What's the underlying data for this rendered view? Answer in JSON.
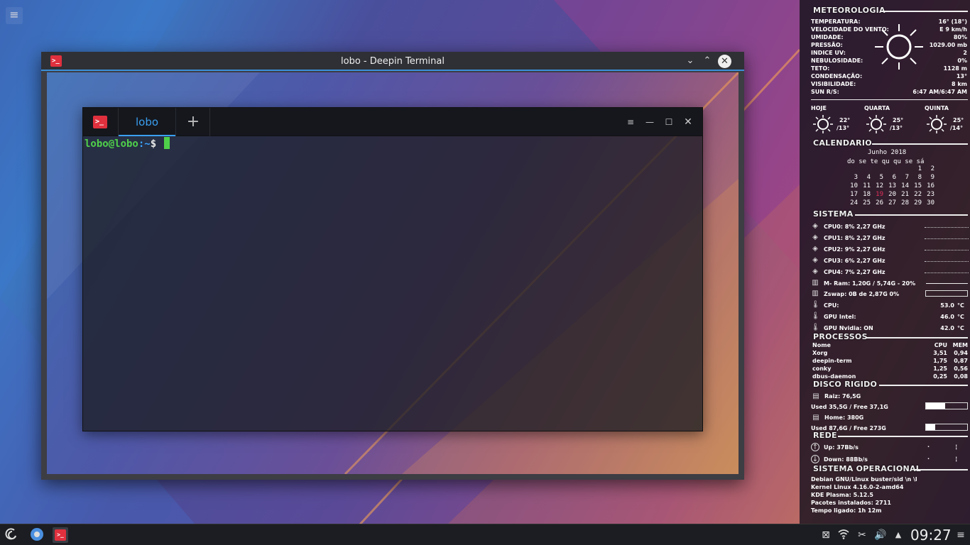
{
  "outer_window": {
    "title": "lobo - Deepin Terminal",
    "icon_glyph": ">_",
    "min": "⌄",
    "max": "⌃",
    "close": "✕"
  },
  "terminal": {
    "icon_glyph": ">_",
    "tab_label": "lobo",
    "add_tab": "+",
    "menu": "≡",
    "min": "—",
    "max": "☐",
    "close": "✕",
    "prompt_user": "lobo@lobo",
    "prompt_path": ":~",
    "prompt_symbol": "$ "
  },
  "desktop": {
    "menu_glyph": "≡"
  },
  "conky": {
    "meteorologia": {
      "title": "METEOROLOGIA",
      "rows": [
        {
          "k": "TEMPERATURA:",
          "v": "16° (18°)"
        },
        {
          "k": "VELOCIDADE DO VENTO:",
          "v": "E 9 km/h"
        },
        {
          "k": "UMIDADE:",
          "v": "80%"
        },
        {
          "k": "PRESSÃO:",
          "v": "1029.00 mb"
        },
        {
          "k": "INDICE UV:",
          "v": "2"
        },
        {
          "k": "NEBULOSIDADE:",
          "v": "0%"
        },
        {
          "k": "TETO:",
          "v": "1128 m"
        },
        {
          "k": "CONDENSAÇÃO:",
          "v": "13°"
        },
        {
          "k": "VISIBILIDADE:",
          "v": "8 km"
        },
        {
          "k": "SUN R/S:",
          "v": "6:47 AM/6:47 AM"
        }
      ],
      "forecast": [
        {
          "day": "HOJE",
          "hi": "22°",
          "lo": "/13°"
        },
        {
          "day": "QUARTA",
          "hi": "25°",
          "lo": "/13°"
        },
        {
          "day": "QUINTA",
          "hi": "25°",
          "lo": "/14°"
        }
      ]
    },
    "calendario": {
      "title": "CALENDARIO",
      "month": "Junho 2018",
      "weekdays": "do se te qu qu se sá",
      "weeks": [
        [
          "",
          "",
          "",
          "",
          "",
          "1",
          "2"
        ],
        [
          "3",
          "4",
          "5",
          "6",
          "7",
          "8",
          "9"
        ],
        [
          "10",
          "11",
          "12",
          "13",
          "14",
          "15",
          "16"
        ],
        [
          "17",
          "18",
          "19",
          "20",
          "21",
          "22",
          "23"
        ],
        [
          "24",
          "25",
          "26",
          "27",
          "28",
          "29",
          "30"
        ]
      ],
      "today": "19"
    },
    "sistema": {
      "title": "SISTEMA",
      "cpus": [
        {
          "label": "CPU0: 8%  2,27 GHz"
        },
        {
          "label": "CPU1: 8%  2,27 GHz"
        },
        {
          "label": "CPU2: 9%  2,27 GHz"
        },
        {
          "label": "CPU3: 6%  2,27 GHz"
        },
        {
          "label": "CPU4: 7%  2,27 GHz"
        }
      ],
      "ram": {
        "label": "M- Ram:  1,20G / 5,74G - 20%",
        "fraction": 0.2
      },
      "swap": {
        "label": "Zswap:  0B de 2,87G  0%",
        "fraction": 0
      },
      "temps": [
        {
          "k": "CPU:",
          "v": "53.0",
          "u": "°C"
        },
        {
          "k": "GPU Intel:",
          "v": "46.0",
          "u": "°C"
        },
        {
          "k": "GPU Nvidia: ON",
          "v": "42.0",
          "u": "°C"
        }
      ]
    },
    "processos": {
      "title": "PROCESSOS",
      "header": {
        "name": "Nome",
        "cpu": "CPU",
        "mem": "MEM"
      },
      "rows": [
        {
          "name": "Xorg",
          "cpu": "3,51",
          "mem": "0,94"
        },
        {
          "name": "deepin-term",
          "cpu": "1,75",
          "mem": "0,87"
        },
        {
          "name": "conky",
          "cpu": "1,25",
          "mem": "0,56"
        },
        {
          "name": "dbus-daemon",
          "cpu": "0,25",
          "mem": "0,08"
        }
      ]
    },
    "disco": {
      "title": "DISCO RIGIDO",
      "disks": [
        {
          "name": "Raiz: 76,5G",
          "usage": "Used 35,5G / Free 37,1G",
          "fraction": 0.46
        },
        {
          "name": "Home: 380G",
          "usage": "Used 87,6G / Free 273G",
          "fraction": 0.23
        }
      ]
    },
    "rede": {
      "title": "REDE",
      "up": "Up: 37Bb/s",
      "down": "Down: 88Bb/s"
    },
    "so": {
      "title": "SISTEMA OPERACIONAL",
      "lines": [
        "Debian GNU/Linux buster/sid \\n \\l",
        "Kernel Linux 4.16.0-2-amd64",
        "KDE Plasma:  5.12.5",
        "Pacotes instalados: 2711",
        "Tempo ligado: 1h 12m"
      ]
    }
  },
  "taskbar": {
    "clock": "09:27"
  }
}
